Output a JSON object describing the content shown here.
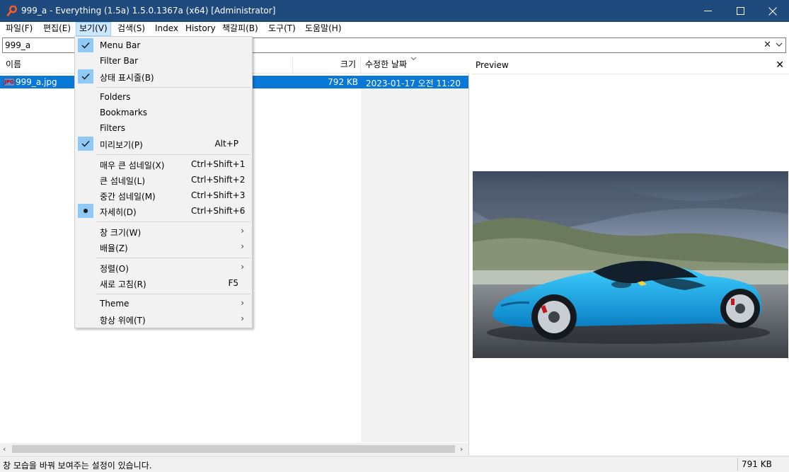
{
  "window": {
    "title": "999_a - Everything (1.5a) 1.5.0.1367a (x64) [Administrator]"
  },
  "menubar": {
    "items": [
      {
        "label": "파일(F)"
      },
      {
        "label": "편집(E)"
      },
      {
        "label": "보기(V)"
      },
      {
        "label": "검색(S)"
      },
      {
        "label": "Index"
      },
      {
        "label": "History"
      },
      {
        "label": "책갈피(B)"
      },
      {
        "label": "도구(T)"
      },
      {
        "label": "도움말(H)"
      }
    ]
  },
  "search": {
    "value": "999_a",
    "clear_glyph": "✕"
  },
  "columns": {
    "name": "이름",
    "size": "크기",
    "date": "수정한 날짜"
  },
  "results": [
    {
      "icon_text": "JPG",
      "name": "999_a.jpg",
      "size": "792 KB",
      "date": "2023-01-17 오전 11:20",
      "selected": true
    }
  ],
  "preview": {
    "title": "Preview",
    "close_glyph": "✕"
  },
  "status": {
    "text": "창 모습을 바꿔 보여주는 설정이 있습니다.",
    "size": "791 KB"
  },
  "view_menu": {
    "items": [
      {
        "label": "Menu Bar",
        "checked": true
      },
      {
        "label": "Filter Bar"
      },
      {
        "label": "상태 표시줄(B)",
        "checked": true
      },
      {
        "label": "Folders"
      },
      {
        "label": "Bookmarks"
      },
      {
        "label": "Filters"
      },
      {
        "label": "미리보기(P)",
        "checked": true,
        "shortcut": "Alt+P"
      },
      {
        "label": "매우 큰 섬네일(X)",
        "shortcut": "Ctrl+Shift+1"
      },
      {
        "label": "큰 섬네일(L)",
        "shortcut": "Ctrl+Shift+2"
      },
      {
        "label": "중간 섬네일(M)",
        "shortcut": "Ctrl+Shift+3"
      },
      {
        "label": "자세히(D)",
        "radio": true,
        "shortcut": "Ctrl+Shift+6"
      },
      {
        "label": "창 크기(W)",
        "submenu": true
      },
      {
        "label": "배율(Z)",
        "submenu": true
      },
      {
        "label": "정렬(O)",
        "submenu": true
      },
      {
        "label": "새로 고침(R)",
        "shortcut": "F5"
      },
      {
        "label": "Theme",
        "submenu": true
      },
      {
        "label": "항상 위에(T)",
        "submenu": true
      }
    ]
  },
  "colors": {
    "titlebar": "#1e4a7e",
    "selection": "#0a78d7",
    "menu_check": "#90c8f6",
    "menu_hover": "#cce8ff"
  }
}
